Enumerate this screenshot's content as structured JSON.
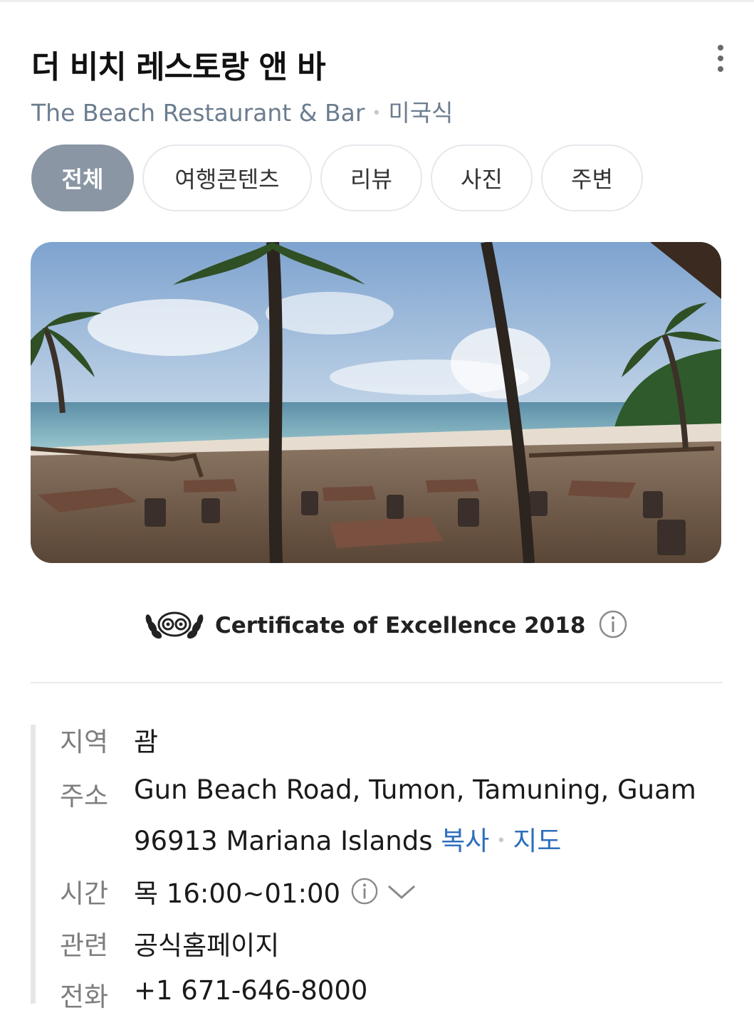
{
  "header": {
    "title": "더 비치 레스토랑 앤 바",
    "subtitle_en": "The Beach Restaurant & Bar",
    "subtitle_sep": "•",
    "subtitle_category": "미국식",
    "more_icon": "more-vertical-icon"
  },
  "tabs": [
    {
      "label": "전체",
      "active": true
    },
    {
      "label": "여행콘텐츠",
      "active": false
    },
    {
      "label": "리뷰",
      "active": false
    },
    {
      "label": "사진",
      "active": false
    },
    {
      "label": "주변",
      "active": false
    }
  ],
  "photo": {
    "icon": "restaurant-photo"
  },
  "certificate": {
    "text": "Certificate of Excellence 2018",
    "badge_icon": "tripadvisor-laurel-icon",
    "info_icon": "info-icon"
  },
  "details": {
    "region": {
      "label": "지역",
      "value": "괌"
    },
    "address": {
      "label": "주소",
      "line1": "Gun Beach Road, Tumon, Tamuning, Guam",
      "line2": "96913 Mariana Islands",
      "copy_link": "복사",
      "sep": "•",
      "map_link": "지도"
    },
    "hours": {
      "label": "시간",
      "value": "목 16:00~01:00",
      "info_icon": "info-icon",
      "expand_icon": "chevron-down-icon"
    },
    "related": {
      "label": "관련",
      "value": "공식홈페이지"
    },
    "phone": {
      "label": "전화",
      "value": "+1 671-646-8000"
    }
  },
  "colors": {
    "accent_link": "#2f6fbd",
    "tab_active_bg": "#8a96a3",
    "subtitle": "#6b7d8f"
  }
}
